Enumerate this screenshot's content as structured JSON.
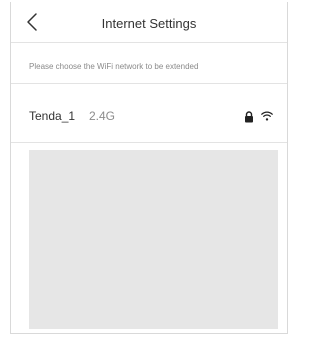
{
  "header": {
    "title": "Internet Settings",
    "back_icon": "chevron-left-icon"
  },
  "hint": "Please choose the WiFi network to be extended",
  "networks": [
    {
      "ssid": "Tenda_1",
      "band": "2.4G",
      "secured": true,
      "signal": "full",
      "lock_icon": "lock-icon",
      "wifi_icon": "wifi-icon"
    }
  ],
  "colors": {
    "text": "#333333",
    "secondary_text": "#8c8c8c",
    "divider": "#e3e3e3",
    "panel": "#e6e6e6"
  }
}
